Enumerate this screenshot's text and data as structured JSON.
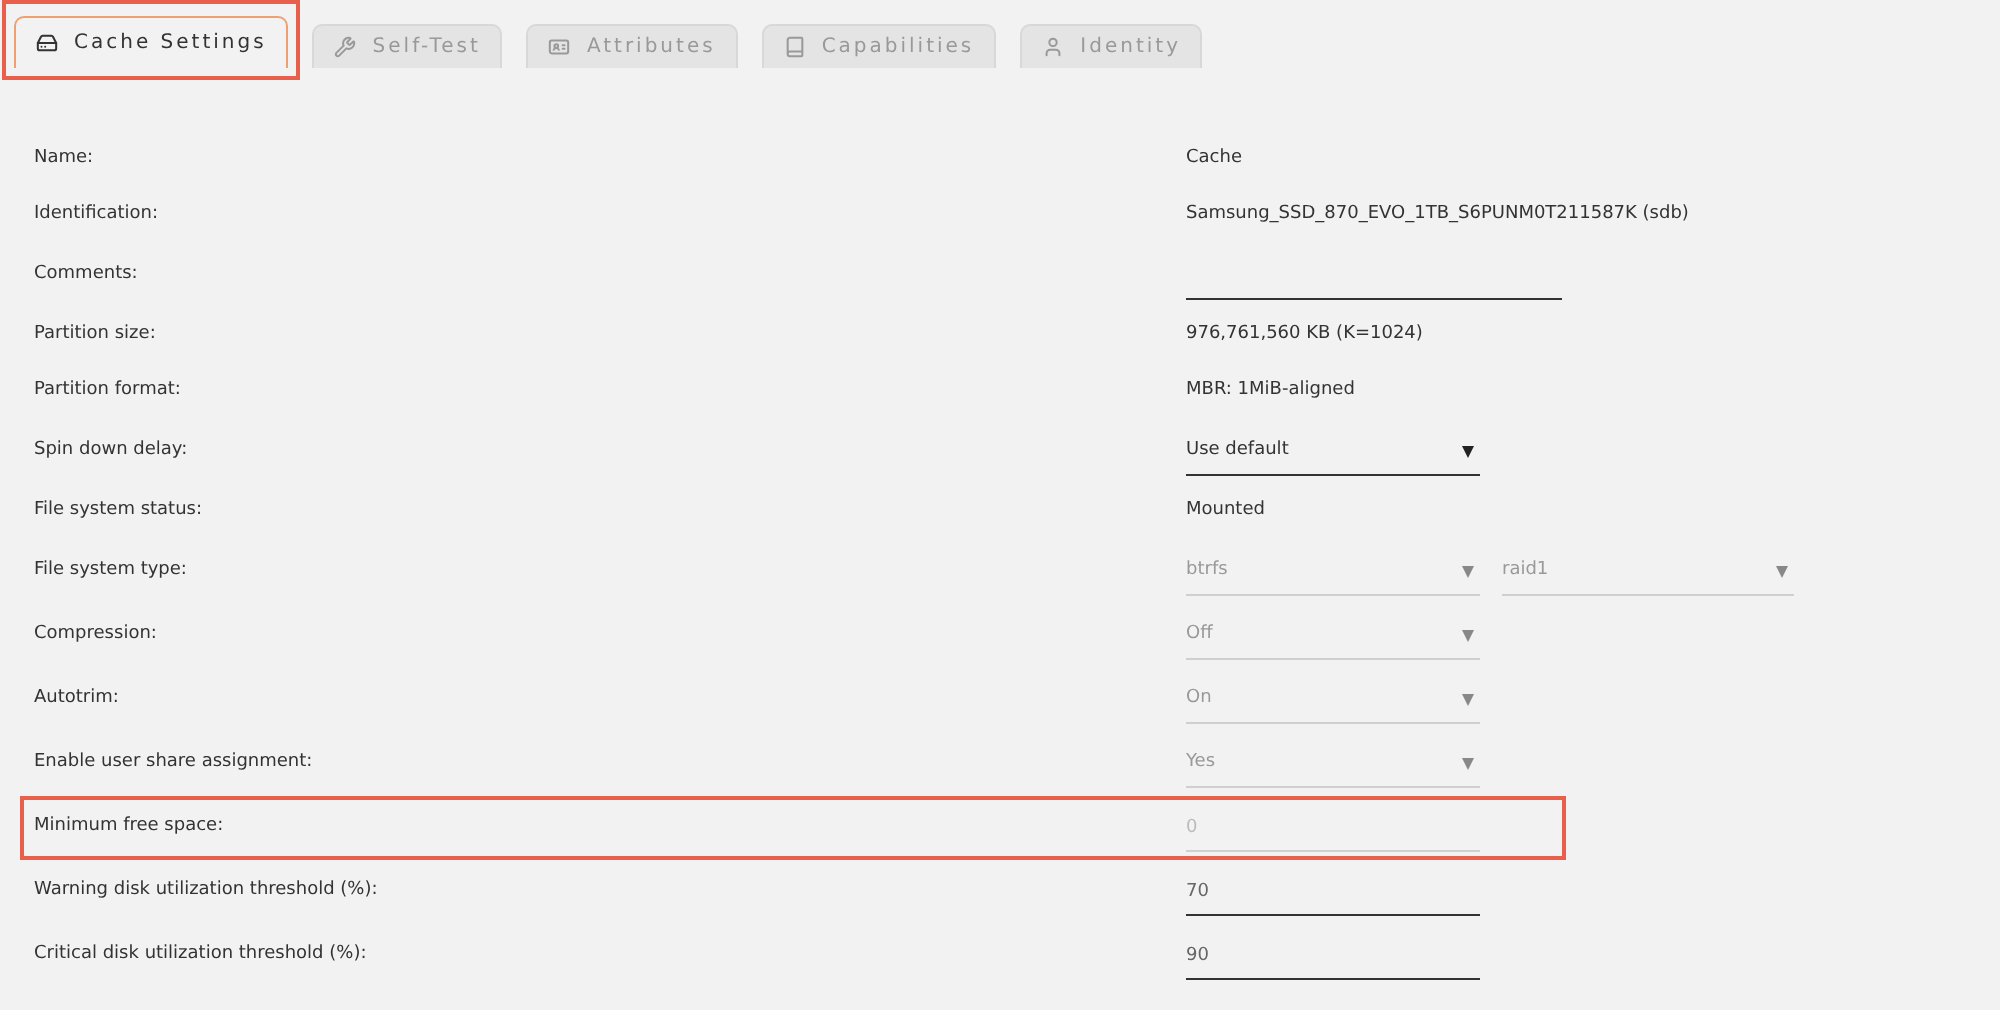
{
  "tabs": [
    {
      "label": "Cache Settings",
      "selected": true,
      "highlighted": true
    },
    {
      "label": "Self-Test",
      "selected": false,
      "highlighted": false
    },
    {
      "label": "Attributes",
      "selected": false,
      "highlighted": false
    },
    {
      "label": "Capabilities",
      "selected": false,
      "highlighted": false
    },
    {
      "label": "Identity",
      "selected": false,
      "highlighted": false
    }
  ],
  "settings": [
    {
      "label": "Name:",
      "kind": "text",
      "value": "Cache",
      "highlighted": false
    },
    {
      "label": "Identification:",
      "kind": "text",
      "value": "Samsung_SSD_870_EVO_1TB_S6PUNM0T211587K (sdb)",
      "highlighted": false
    },
    {
      "label": "Comments:",
      "kind": "input",
      "wide": true,
      "disabled": false,
      "highlighted": false
    },
    {
      "label": "Partition size:",
      "kind": "text",
      "value": "976,761,560 KB (K=1024)",
      "highlighted": false
    },
    {
      "label": "Partition format:",
      "kind": "text",
      "value": "MBR: 1MiB-aligned",
      "highlighted": false
    },
    {
      "label": "Spin down delay:",
      "kind": "select",
      "selects": [
        {
          "value": "Use default",
          "disabled": false
        }
      ],
      "highlighted": false
    },
    {
      "label": "File system status:",
      "kind": "text",
      "value": "Mounted",
      "highlighted": false
    },
    {
      "label": "File system type:",
      "kind": "select",
      "selects": [
        {
          "value": "btrfs",
          "disabled": true
        },
        {
          "value": "raid1",
          "disabled": true
        }
      ],
      "highlighted": false
    },
    {
      "label": "Compression:",
      "kind": "select",
      "selects": [
        {
          "value": "Off",
          "disabled": true
        }
      ],
      "highlighted": false
    },
    {
      "label": "Autotrim:",
      "kind": "select",
      "selects": [
        {
          "value": "On",
          "disabled": true
        }
      ],
      "highlighted": false
    },
    {
      "label": "Enable user share assignment:",
      "kind": "select",
      "selects": [
        {
          "value": "Yes",
          "disabled": true
        }
      ],
      "highlighted": false
    },
    {
      "label": "Minimum free space:",
      "kind": "input",
      "placeholder": "0",
      "wide": false,
      "disabled": true,
      "highlighted": true
    },
    {
      "label": "Warning disk utilization threshold (%):",
      "kind": "input",
      "value": "70",
      "wide": false,
      "disabled": false,
      "highlighted": false
    },
    {
      "label": "Critical disk utilization threshold (%):",
      "kind": "input",
      "value": "90",
      "wide": false,
      "disabled": false,
      "highlighted": false
    }
  ]
}
